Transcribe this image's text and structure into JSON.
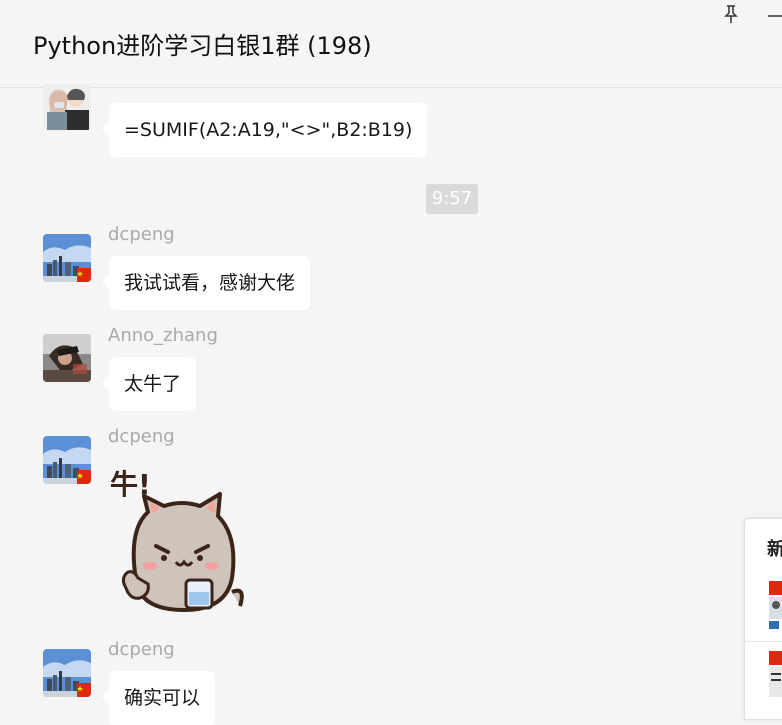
{
  "window": {
    "title": "Python进阶学习白银1群 (198)",
    "pin_icon": "pin-icon",
    "minimize_icon": "minimize-icon"
  },
  "messages": [
    {
      "sender": "",
      "avatar": "avatar-couple",
      "text": "=SUMIF(A2:A19,\"<>\",B2:B19)"
    },
    {
      "sender": "dcpeng",
      "avatar": "avatar-city-skyline",
      "text": "我试试看，感谢大佬"
    },
    {
      "sender": "Anno_zhang",
      "avatar": "avatar-person-photo",
      "text": "太牛了"
    },
    {
      "sender": "dcpeng",
      "avatar": "avatar-city-skyline",
      "sticker": {
        "caption": "牛!",
        "name": "cat-thumbs-up-sticker"
      }
    },
    {
      "sender": "dcpeng",
      "avatar": "avatar-city-skyline",
      "text": "确实可以"
    }
  ],
  "timestamp": "9:57",
  "side_panel": {
    "title": "新"
  },
  "colors": {
    "background": "#f5f5f5",
    "bubble": "#ffffff",
    "sender_name": "#a9a9a9",
    "timestamp_bg": "#dadada"
  }
}
